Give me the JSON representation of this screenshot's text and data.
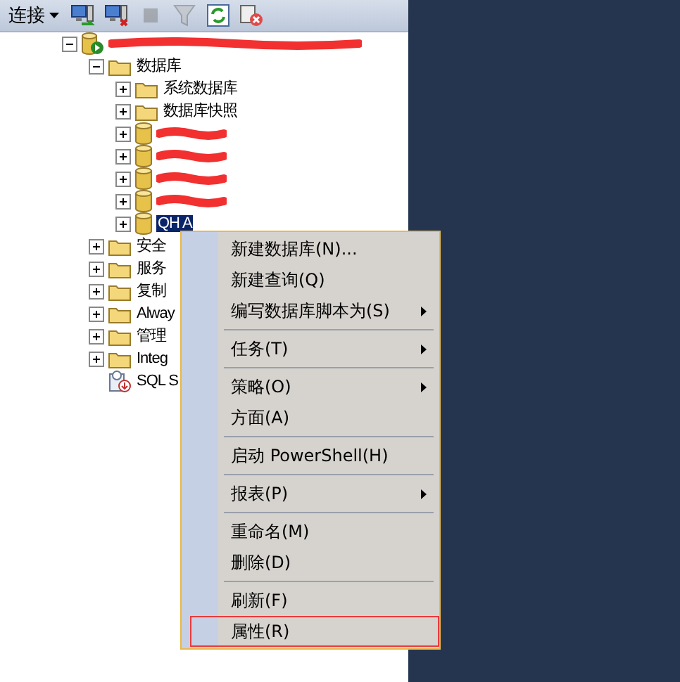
{
  "toolbar": {
    "connect_label": "连接",
    "buttons": [
      {
        "kind": "connect",
        "disabled": false
      },
      {
        "kind": "disconnect",
        "disabled": false
      },
      {
        "kind": "stop",
        "disabled": true
      },
      {
        "kind": "filter",
        "disabled": true
      },
      {
        "kind": "refresh",
        "disabled": false
      },
      {
        "kind": "cancel",
        "disabled": false
      }
    ]
  },
  "tree": [
    {
      "kind": "server",
      "expanded": true,
      "selected": false,
      "children": [
        {
          "kind": "folder",
          "label": "数据库",
          "expanded": true,
          "selected": false,
          "children": [
            {
              "kind": "folder",
              "label": "系统数据库",
              "expanded": false,
              "selected": false
            },
            {
              "kind": "folder",
              "label": "数据库快照",
              "expanded": false,
              "selected": false
            },
            {
              "kind": "database",
              "expanded": false,
              "selected": false
            },
            {
              "kind": "database",
              "expanded": false,
              "selected": false
            },
            {
              "kind": "database",
              "expanded": false,
              "selected": false
            },
            {
              "kind": "database",
              "expanded": false,
              "selected": false
            },
            {
              "kind": "database",
              "label": "QH A",
              "expanded": false,
              "selected": true
            }
          ]
        },
        {
          "kind": "folder",
          "label": "安全",
          "expanded": false,
          "selected": false
        },
        {
          "kind": "folder",
          "label": "服务",
          "expanded": false,
          "selected": false
        },
        {
          "kind": "folder",
          "label": "复制",
          "expanded": false,
          "selected": false
        },
        {
          "kind": "folder",
          "label": "Alway",
          "expanded": false,
          "selected": false
        },
        {
          "kind": "folder",
          "label": "管理",
          "expanded": false,
          "selected": false
        },
        {
          "kind": "folder",
          "label": "Integ",
          "expanded": false,
          "selected": false
        },
        {
          "kind": "agent",
          "label": "SQL S",
          "selected": false
        }
      ]
    }
  ],
  "context_menu": [
    {
      "kind": "item",
      "label": "新建数据库(N)...",
      "submenu": false,
      "outlined": false
    },
    {
      "kind": "item",
      "label": "新建查询(Q)",
      "submenu": false,
      "outlined": false
    },
    {
      "kind": "item",
      "label": "编写数据库脚本为(S)",
      "submenu": true,
      "outlined": false
    },
    {
      "kind": "separator"
    },
    {
      "kind": "item",
      "label": "任务(T)",
      "submenu": true,
      "outlined": false
    },
    {
      "kind": "separator"
    },
    {
      "kind": "item",
      "label": "策略(O)",
      "submenu": true,
      "outlined": false
    },
    {
      "kind": "item",
      "label": "方面(A)",
      "submenu": false,
      "outlined": false
    },
    {
      "kind": "separator"
    },
    {
      "kind": "item",
      "label": "启动 PowerShell(H)",
      "submenu": false,
      "outlined": false
    },
    {
      "kind": "separator"
    },
    {
      "kind": "item",
      "label": "报表(P)",
      "submenu": true,
      "outlined": false
    },
    {
      "kind": "separator"
    },
    {
      "kind": "item",
      "label": "重命名(M)",
      "submenu": false,
      "outlined": false
    },
    {
      "kind": "item",
      "label": "删除(D)",
      "submenu": false,
      "outlined": false
    },
    {
      "kind": "separator"
    },
    {
      "kind": "item",
      "label": "刷新(F)",
      "submenu": false,
      "outlined": false
    },
    {
      "kind": "item",
      "label": "属性(R)",
      "submenu": false,
      "outlined": true
    }
  ]
}
